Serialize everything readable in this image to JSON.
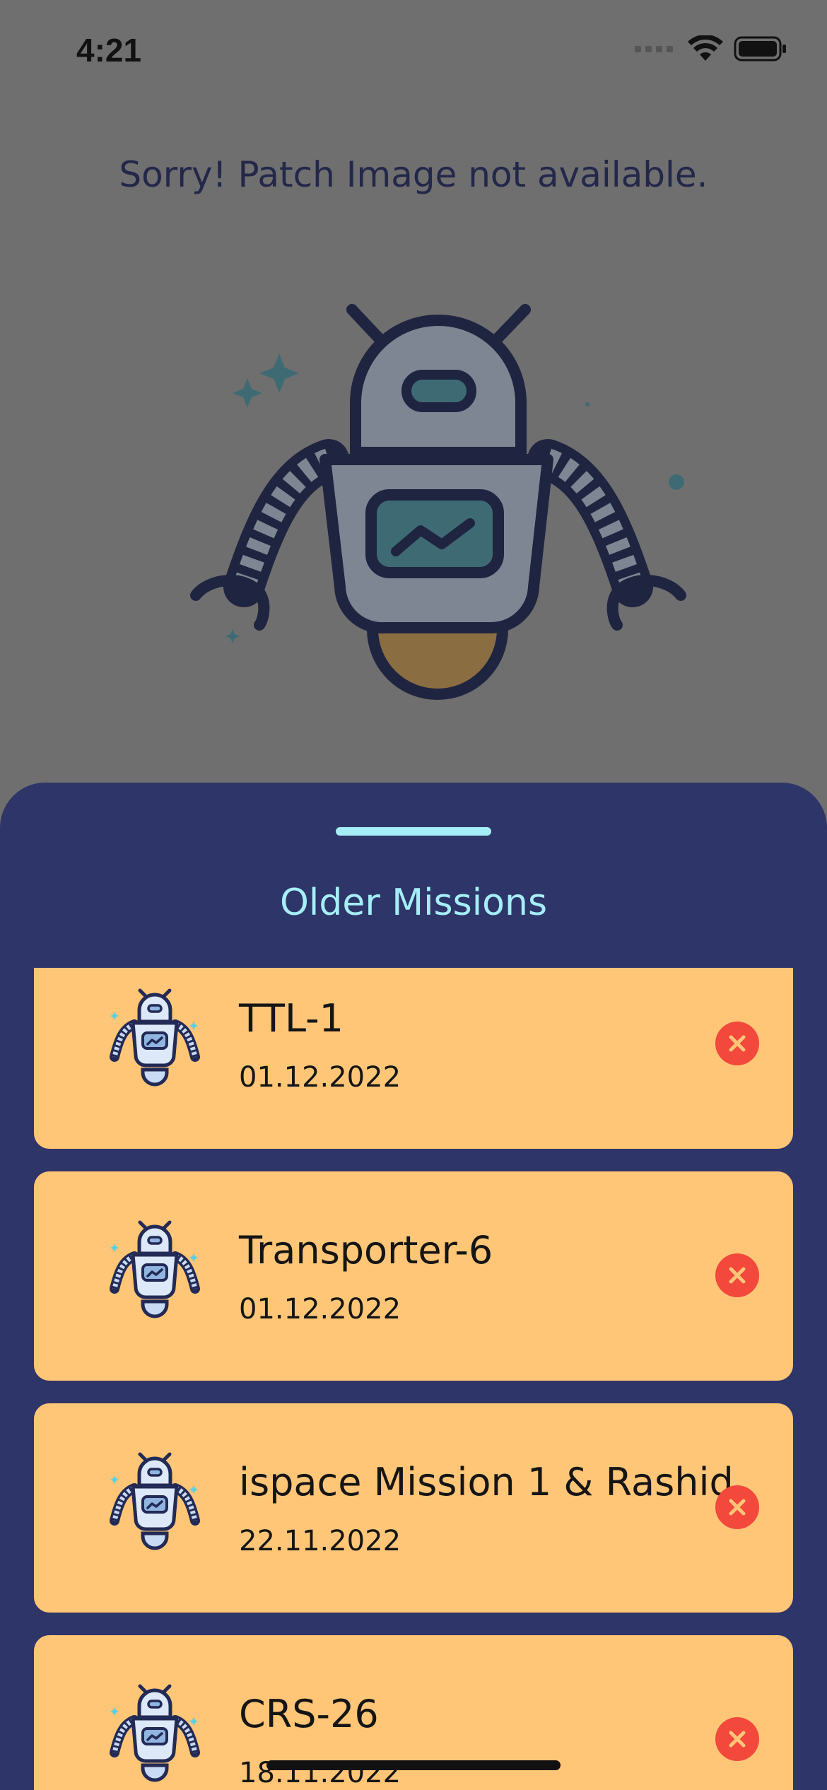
{
  "status_bar": {
    "time": "4:21",
    "icons": [
      "cellular-signal-icon",
      "wifi-icon",
      "battery-icon"
    ]
  },
  "backdrop": {
    "message": "Sorry! Patch Image not available.",
    "illustration": "robot-illustration-icon"
  },
  "sheet": {
    "title": "Older Missions",
    "background": "#2e3568",
    "accent": "#a5eef7"
  },
  "missions": [
    {
      "name": "TTL-1",
      "date": "01.12.2022"
    },
    {
      "name": "Transporter-6",
      "date": "01.12.2022"
    },
    {
      "name": "ispace Mission 1 & Rashid",
      "date": "22.11.2022"
    },
    {
      "name": "CRS-26",
      "date": "18.11.2022"
    }
  ],
  "colors": {
    "card": "#ffc677",
    "delete": "#f2493c",
    "overlay": "#6f6f6f"
  }
}
